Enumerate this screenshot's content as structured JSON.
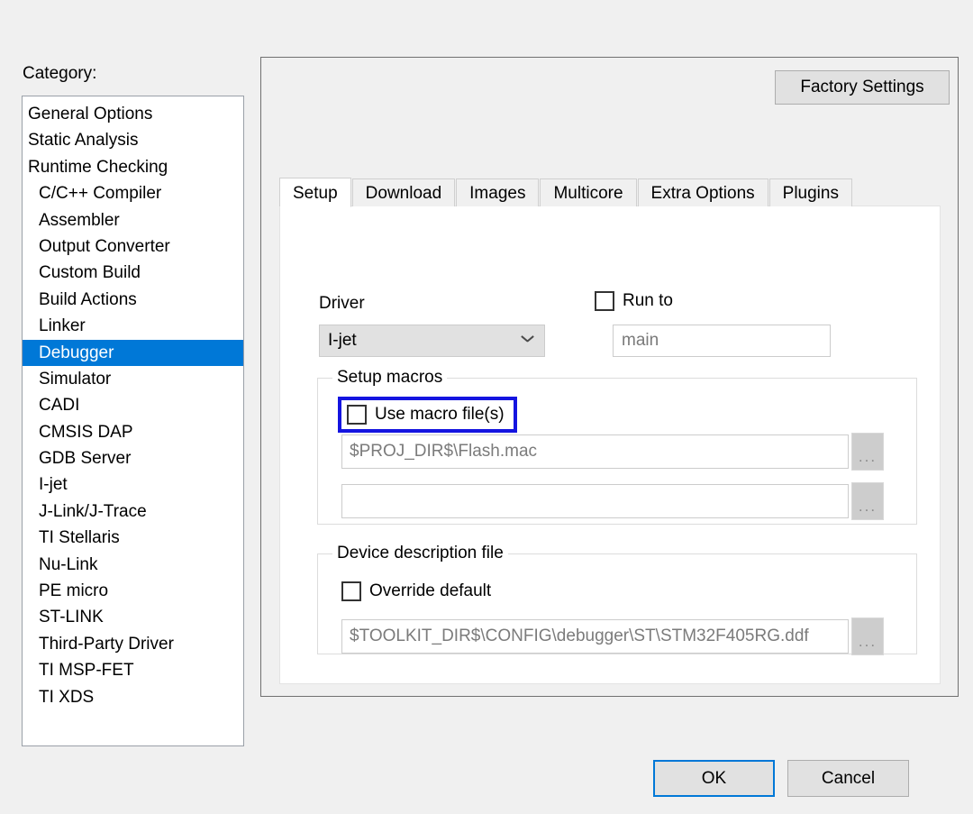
{
  "sidebar": {
    "label": "Category:",
    "items": [
      {
        "label": "General Options",
        "indent": false,
        "selected": false
      },
      {
        "label": "Static Analysis",
        "indent": false,
        "selected": false
      },
      {
        "label": "Runtime Checking",
        "indent": false,
        "selected": false
      },
      {
        "label": "C/C++ Compiler",
        "indent": true,
        "selected": false
      },
      {
        "label": "Assembler",
        "indent": true,
        "selected": false
      },
      {
        "label": "Output Converter",
        "indent": true,
        "selected": false
      },
      {
        "label": "Custom Build",
        "indent": true,
        "selected": false
      },
      {
        "label": "Build Actions",
        "indent": true,
        "selected": false
      },
      {
        "label": "Linker",
        "indent": true,
        "selected": false
      },
      {
        "label": "Debugger",
        "indent": true,
        "selected": true
      },
      {
        "label": "Simulator",
        "indent": true,
        "selected": false
      },
      {
        "label": "CADI",
        "indent": true,
        "selected": false
      },
      {
        "label": "CMSIS DAP",
        "indent": true,
        "selected": false
      },
      {
        "label": "GDB Server",
        "indent": true,
        "selected": false
      },
      {
        "label": "I-jet",
        "indent": true,
        "selected": false
      },
      {
        "label": "J-Link/J-Trace",
        "indent": true,
        "selected": false
      },
      {
        "label": "TI Stellaris",
        "indent": true,
        "selected": false
      },
      {
        "label": "Nu-Link",
        "indent": true,
        "selected": false
      },
      {
        "label": "PE micro",
        "indent": true,
        "selected": false
      },
      {
        "label": "ST-LINK",
        "indent": true,
        "selected": false
      },
      {
        "label": "Third-Party Driver",
        "indent": true,
        "selected": false
      },
      {
        "label": "TI MSP-FET",
        "indent": true,
        "selected": false
      },
      {
        "label": "TI XDS",
        "indent": true,
        "selected": false
      }
    ]
  },
  "panel": {
    "factory_settings_label": "Factory Settings",
    "tabs": [
      {
        "label": "Setup",
        "active": true
      },
      {
        "label": "Download",
        "active": false
      },
      {
        "label": "Images",
        "active": false
      },
      {
        "label": "Multicore",
        "active": false
      },
      {
        "label": "Extra Options",
        "active": false
      },
      {
        "label": "Plugins",
        "active": false
      }
    ]
  },
  "setup": {
    "driver": {
      "label": "Driver",
      "selected_value": "I-jet",
      "chevron_icon": "chevron-down-icon"
    },
    "run_to": {
      "label": "Run to",
      "checked": false,
      "input_value": "",
      "input_placeholder": "main"
    },
    "setup_macros": {
      "title": "Setup macros",
      "use_macro_files": {
        "label": "Use macro file(s)",
        "checked": false,
        "highlight_color": "#1414e0"
      },
      "macro_file_1": "$PROJ_DIR$\\Flash.mac",
      "macro_file_2": "",
      "browse_label": "..."
    },
    "device_description": {
      "title": "Device description file",
      "override_default": {
        "label": "Override default",
        "checked": false
      },
      "path": "$TOOLKIT_DIR$\\CONFIG\\debugger\\ST\\STM32F405RG.ddf",
      "browse_label": "..."
    }
  },
  "footer": {
    "ok_label": "OK",
    "cancel_label": "Cancel",
    "focus_color": "#0078d7"
  }
}
